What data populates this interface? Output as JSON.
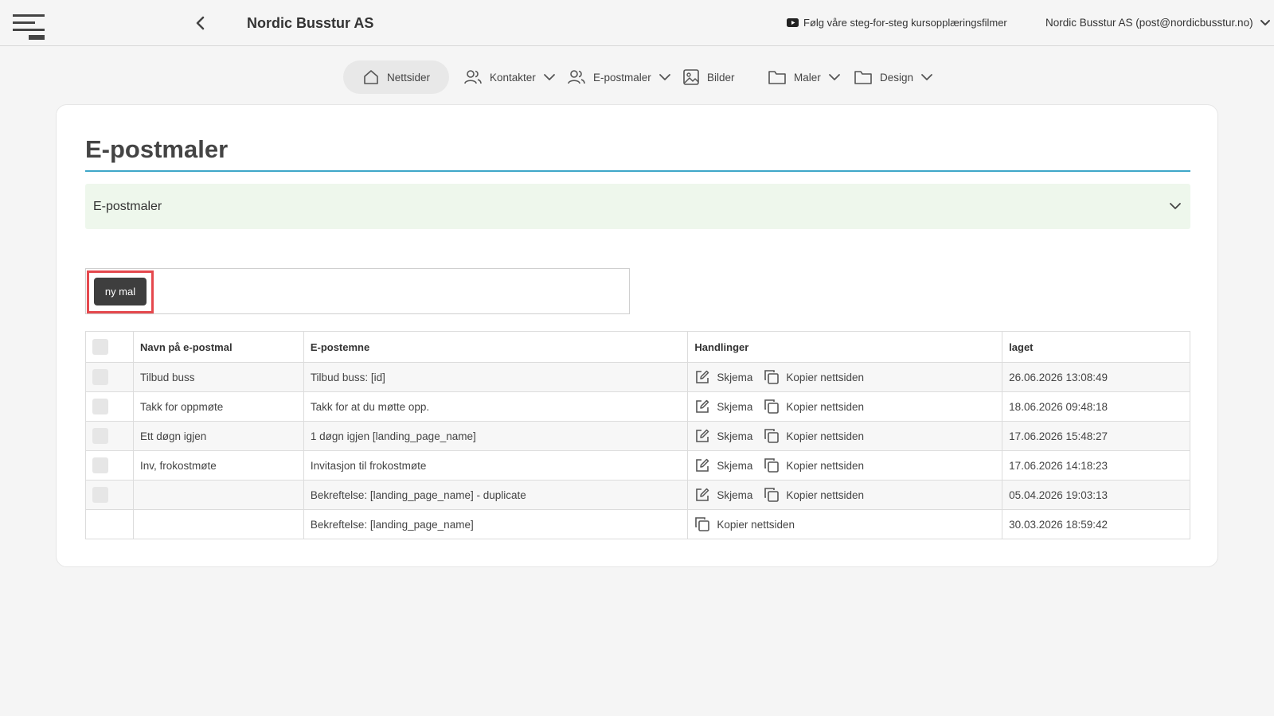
{
  "header": {
    "brand": "Nordic Busstur AS",
    "tutorial_link": "Følg våre steg-for-steg kursopplæringsfilmer",
    "account": "Nordic Busstur AS (post@nordicbusstur.no)"
  },
  "nav": {
    "items": [
      {
        "label": "Nettsider",
        "icon": "home-icon",
        "active": true
      },
      {
        "label": "Kontakter",
        "icon": "users-icon",
        "dropdown": true
      },
      {
        "label": "E-postmaler",
        "icon": "users-icon",
        "dropdown": true
      },
      {
        "label": "Bilder",
        "icon": "image-icon"
      },
      {
        "label": "Maler",
        "icon": "folder-icon",
        "dropdown": true
      },
      {
        "label": "Design",
        "icon": "folder-icon",
        "dropdown": true
      }
    ]
  },
  "main": {
    "title": "E-postmaler",
    "accordion_label": "E-postmaler",
    "new_button": "ny mal"
  },
  "table": {
    "headers": [
      "Navn på e-postmal",
      "E-postemne",
      "Handlinger",
      "laget"
    ],
    "actions": {
      "edit": "Skjema",
      "copy": "Kopier nettsiden"
    },
    "rows": [
      {
        "name": "Tilbud buss",
        "subject": "Tilbud buss: [id]",
        "created": "26.06.2026 13:08:49"
      },
      {
        "name": "Takk for oppmøte",
        "subject": "Takk for at du møtte opp.",
        "created": "18.06.2026 09:48:18"
      },
      {
        "name": "Ett døgn igjen",
        "subject": "1 døgn igjen [landing_page_name]",
        "created": "17.06.2026 15:48:27"
      },
      {
        "name": "Inv, frokostmøte",
        "subject": "Invitasjon til frokostmøte",
        "created": "17.06.2026 14:18:23"
      },
      {
        "name": "",
        "subject": "Bekreftelse: [landing_page_name] - duplicate",
        "created": "05.04.2026 19:03:13"
      },
      {
        "name": "",
        "subject": "Bekreftelse: [landing_page_name]",
        "created": "30.03.2026 18:59:42"
      }
    ]
  },
  "colors": {
    "accent_rule": "#3fa7c9",
    "accordion_bg": "#eef7ec",
    "button_bg": "#3e3e3e",
    "highlight": "#e5484d"
  }
}
